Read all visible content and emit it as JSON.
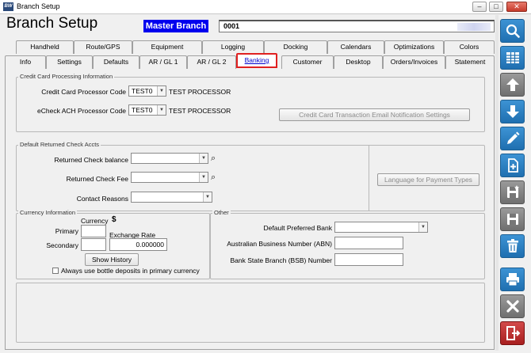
{
  "window": {
    "title": "Branch Setup",
    "icon_text": "BW",
    "minimize": "–",
    "maximize": "□",
    "close": "✕"
  },
  "header": {
    "title": "Branch Setup",
    "branch_name": "Master Branch",
    "branch_code": "0001"
  },
  "tabs": {
    "row1": [
      "Handheld",
      "Route/GPS",
      "Equipment",
      "Logging",
      "Docking",
      "Calendars",
      "Optimizations",
      "Colors"
    ],
    "row2": [
      "Info",
      "Settings",
      "Defaults",
      "AR / GL 1",
      "AR / GL 2",
      "Banking",
      "Customer",
      "Desktop",
      "Orders/Invoices",
      "Statement"
    ],
    "active": "Banking"
  },
  "credit_card": {
    "legend": "Credit Card Processing Information",
    "cc_label": "Credit Card Processor Code",
    "cc_value": "TEST0",
    "cc_desc": "TEST PROCESSOR",
    "echeck_label": "eCheck ACH Processor Code",
    "echeck_value": "TEST0",
    "echeck_desc": "TEST PROCESSOR",
    "email_button": "Credit Card Transaction Email Notification Settings"
  },
  "returned_check": {
    "legend": "Default Returned Check Accts",
    "balance_label": "Returned Check balance",
    "fee_label": "Returned Check Fee",
    "contact_label": "Contact Reasons",
    "language_button": "Language for Payment Types"
  },
  "currency": {
    "legend": "Currency Information",
    "currency_header": "Currency",
    "currency_symbol": "$",
    "primary_label": "Primary",
    "secondary_label": "Secondary",
    "exchange_header": "Exchange Rate",
    "exchange_value": "0.000000",
    "show_history": "Show History",
    "bottle_checkbox": "Always use bottle deposits in primary currency"
  },
  "other": {
    "legend": "Other",
    "bank_label": "Default Preferred Bank",
    "abn_label": "Australian Business Number (ABN)",
    "bsb_label": "Bank State Branch (BSB) Number"
  },
  "sidebar": [
    "search-icon",
    "grid-icon",
    "arrow-up-icon",
    "arrow-down-icon",
    "pencil-icon",
    "new-document-icon",
    "save-new-icon",
    "save-icon",
    "trash-icon",
    "print-icon",
    "cancel-icon",
    "exit-icon"
  ]
}
